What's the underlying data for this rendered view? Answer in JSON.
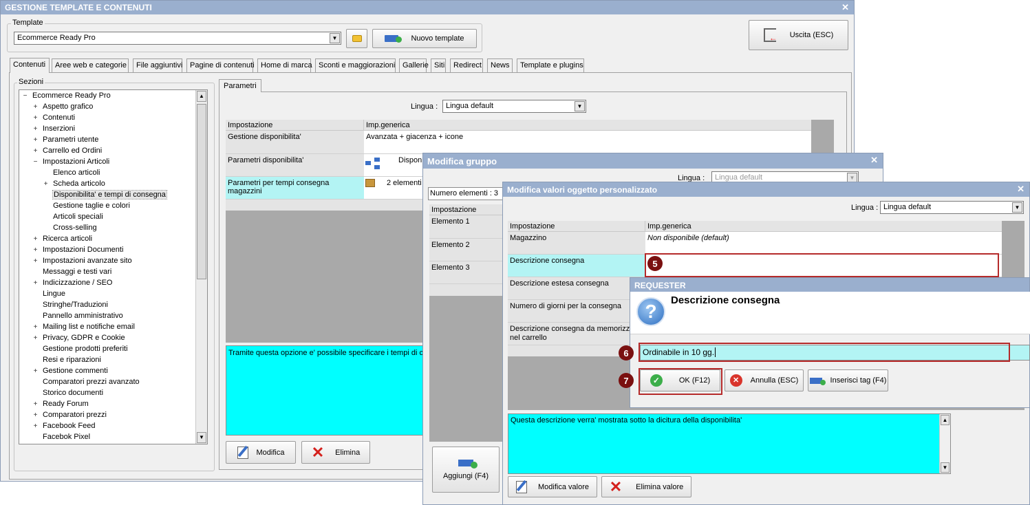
{
  "main": {
    "title": "GESTIONE TEMPLATE E CONTENUTI",
    "template_label": "Template",
    "template_value": "Ecommerce Ready Pro",
    "new_template": "Nuovo template",
    "exit": "Uscita (ESC)",
    "tabs": [
      "Contenuti",
      "Aree web e categorie",
      "File aggiuntivi",
      "Pagine di contenuti",
      "Home di marca",
      "Sconti e maggiorazioni",
      "Gallerie",
      "Siti",
      "Redirect",
      "News",
      "Template e plugins"
    ],
    "sections_label": "Sezioni",
    "tree": [
      {
        "label": "Ecommerce Ready Pro",
        "level": 0,
        "expander": "−"
      },
      {
        "label": "Aspetto grafico",
        "level": 1,
        "expander": "+"
      },
      {
        "label": "Contenuti",
        "level": 1,
        "expander": "+"
      },
      {
        "label": "Inserzioni",
        "level": 1,
        "expander": "+"
      },
      {
        "label": "Parametri utente",
        "level": 1,
        "expander": "+"
      },
      {
        "label": "Carrello ed Ordini",
        "level": 1,
        "expander": "+"
      },
      {
        "label": "Impostazioni Articoli",
        "level": 1,
        "expander": "−"
      },
      {
        "label": "Elenco articoli",
        "level": 2,
        "expander": ""
      },
      {
        "label": "Scheda articolo",
        "level": 2,
        "expander": "+"
      },
      {
        "label": "Disponibilita' e tempi di consegna",
        "level": 2,
        "expander": "",
        "selected": true
      },
      {
        "label": "Gestione taglie e colori",
        "level": 2,
        "expander": ""
      },
      {
        "label": "Articoli speciali",
        "level": 2,
        "expander": ""
      },
      {
        "label": "Cross-selling",
        "level": 2,
        "expander": ""
      },
      {
        "label": "Ricerca articoli",
        "level": 1,
        "expander": "+"
      },
      {
        "label": "Impostazioni Documenti",
        "level": 1,
        "expander": "+"
      },
      {
        "label": "Impostazioni avanzate sito",
        "level": 1,
        "expander": "+"
      },
      {
        "label": "Messaggi e testi vari",
        "level": 1,
        "expander": ""
      },
      {
        "label": "Indicizzazione / SEO",
        "level": 1,
        "expander": "+"
      },
      {
        "label": "Lingue",
        "level": 1,
        "expander": ""
      },
      {
        "label": "Stringhe/Traduzioni",
        "level": 1,
        "expander": ""
      },
      {
        "label": "Pannello amministrativo",
        "level": 1,
        "expander": ""
      },
      {
        "label": "Mailing list e notifiche email",
        "level": 1,
        "expander": "+"
      },
      {
        "label": "Privacy, GDPR e Cookie",
        "level": 1,
        "expander": "+"
      },
      {
        "label": "Gestione prodotti preferiti",
        "level": 1,
        "expander": ""
      },
      {
        "label": "Resi e riparazioni",
        "level": 1,
        "expander": ""
      },
      {
        "label": "Gestione commenti",
        "level": 1,
        "expander": "+"
      },
      {
        "label": "Comparatori prezzi avanzato",
        "level": 1,
        "expander": ""
      },
      {
        "label": "Storico documenti",
        "level": 1,
        "expander": ""
      },
      {
        "label": "Ready Forum",
        "level": 1,
        "expander": "+"
      },
      {
        "label": "Comparatori prezzi",
        "level": 1,
        "expander": "+"
      },
      {
        "label": "Facebook Feed",
        "level": 1,
        "expander": "+"
      },
      {
        "label": "Facebok Pixel",
        "level": 1,
        "expander": ""
      }
    ],
    "params_tab": "Parametri",
    "lingua_label": "Lingua :",
    "lingua_value": "Lingua default",
    "grid_headers": [
      "Impostazione",
      "Imp.generica"
    ],
    "grid_rows": [
      {
        "name": "Gestione disponibilita'",
        "value": "Avanzata + giacenza + icone"
      },
      {
        "name": "Parametri disponibilita'",
        "value": "Disponi"
      },
      {
        "name": "Parametri per tempi consegna magazzini",
        "value": "2 elementi"
      }
    ],
    "description": "Tramite questa opzione e' possibile specificare i tempi di con",
    "edit": "Modifica",
    "delete": "Elimina"
  },
  "group": {
    "title": "Modifica gruppo",
    "lingua_label": "Lingua :",
    "lingua_value": "Lingua default",
    "count": "Numero elementi : 3",
    "header": "Impostazione",
    "items": [
      "Elemento 1",
      "Elemento 2",
      "Elemento 3"
    ],
    "add": "Aggiungi (F4)"
  },
  "custom": {
    "title": "Modifica valori oggetto personalizzato",
    "lingua_label": "Lingua :",
    "lingua_value": "Lingua default",
    "headers": [
      "Impostazione",
      "Imp.generica"
    ],
    "rows": [
      {
        "name": "Magazzino",
        "value": "Non disponibile (default)"
      },
      {
        "name": "Descrizione consegna",
        "value": ""
      },
      {
        "name": "Descrizione estesa consegna",
        "value": ""
      },
      {
        "name": "Numero di giorni per la consegna",
        "value": ""
      },
      {
        "name": "Descrizione consegna da memorizzare nel carrello",
        "value": ""
      }
    ],
    "description": "Questa descrizione verra' mostrata sotto la dicitura della disponibilita'",
    "edit_value": "Modifica valore",
    "delete_value": "Elimina valore"
  },
  "requester": {
    "title": "REQUESTER",
    "heading": "Descrizione consegna",
    "input_value": "Ordinabile in 10 gg.",
    "ok": "OK (F12)",
    "cancel": "Annulla (ESC)",
    "insert_tag": "Inserisci tag (F4)"
  },
  "steps": [
    "5",
    "6",
    "7"
  ]
}
